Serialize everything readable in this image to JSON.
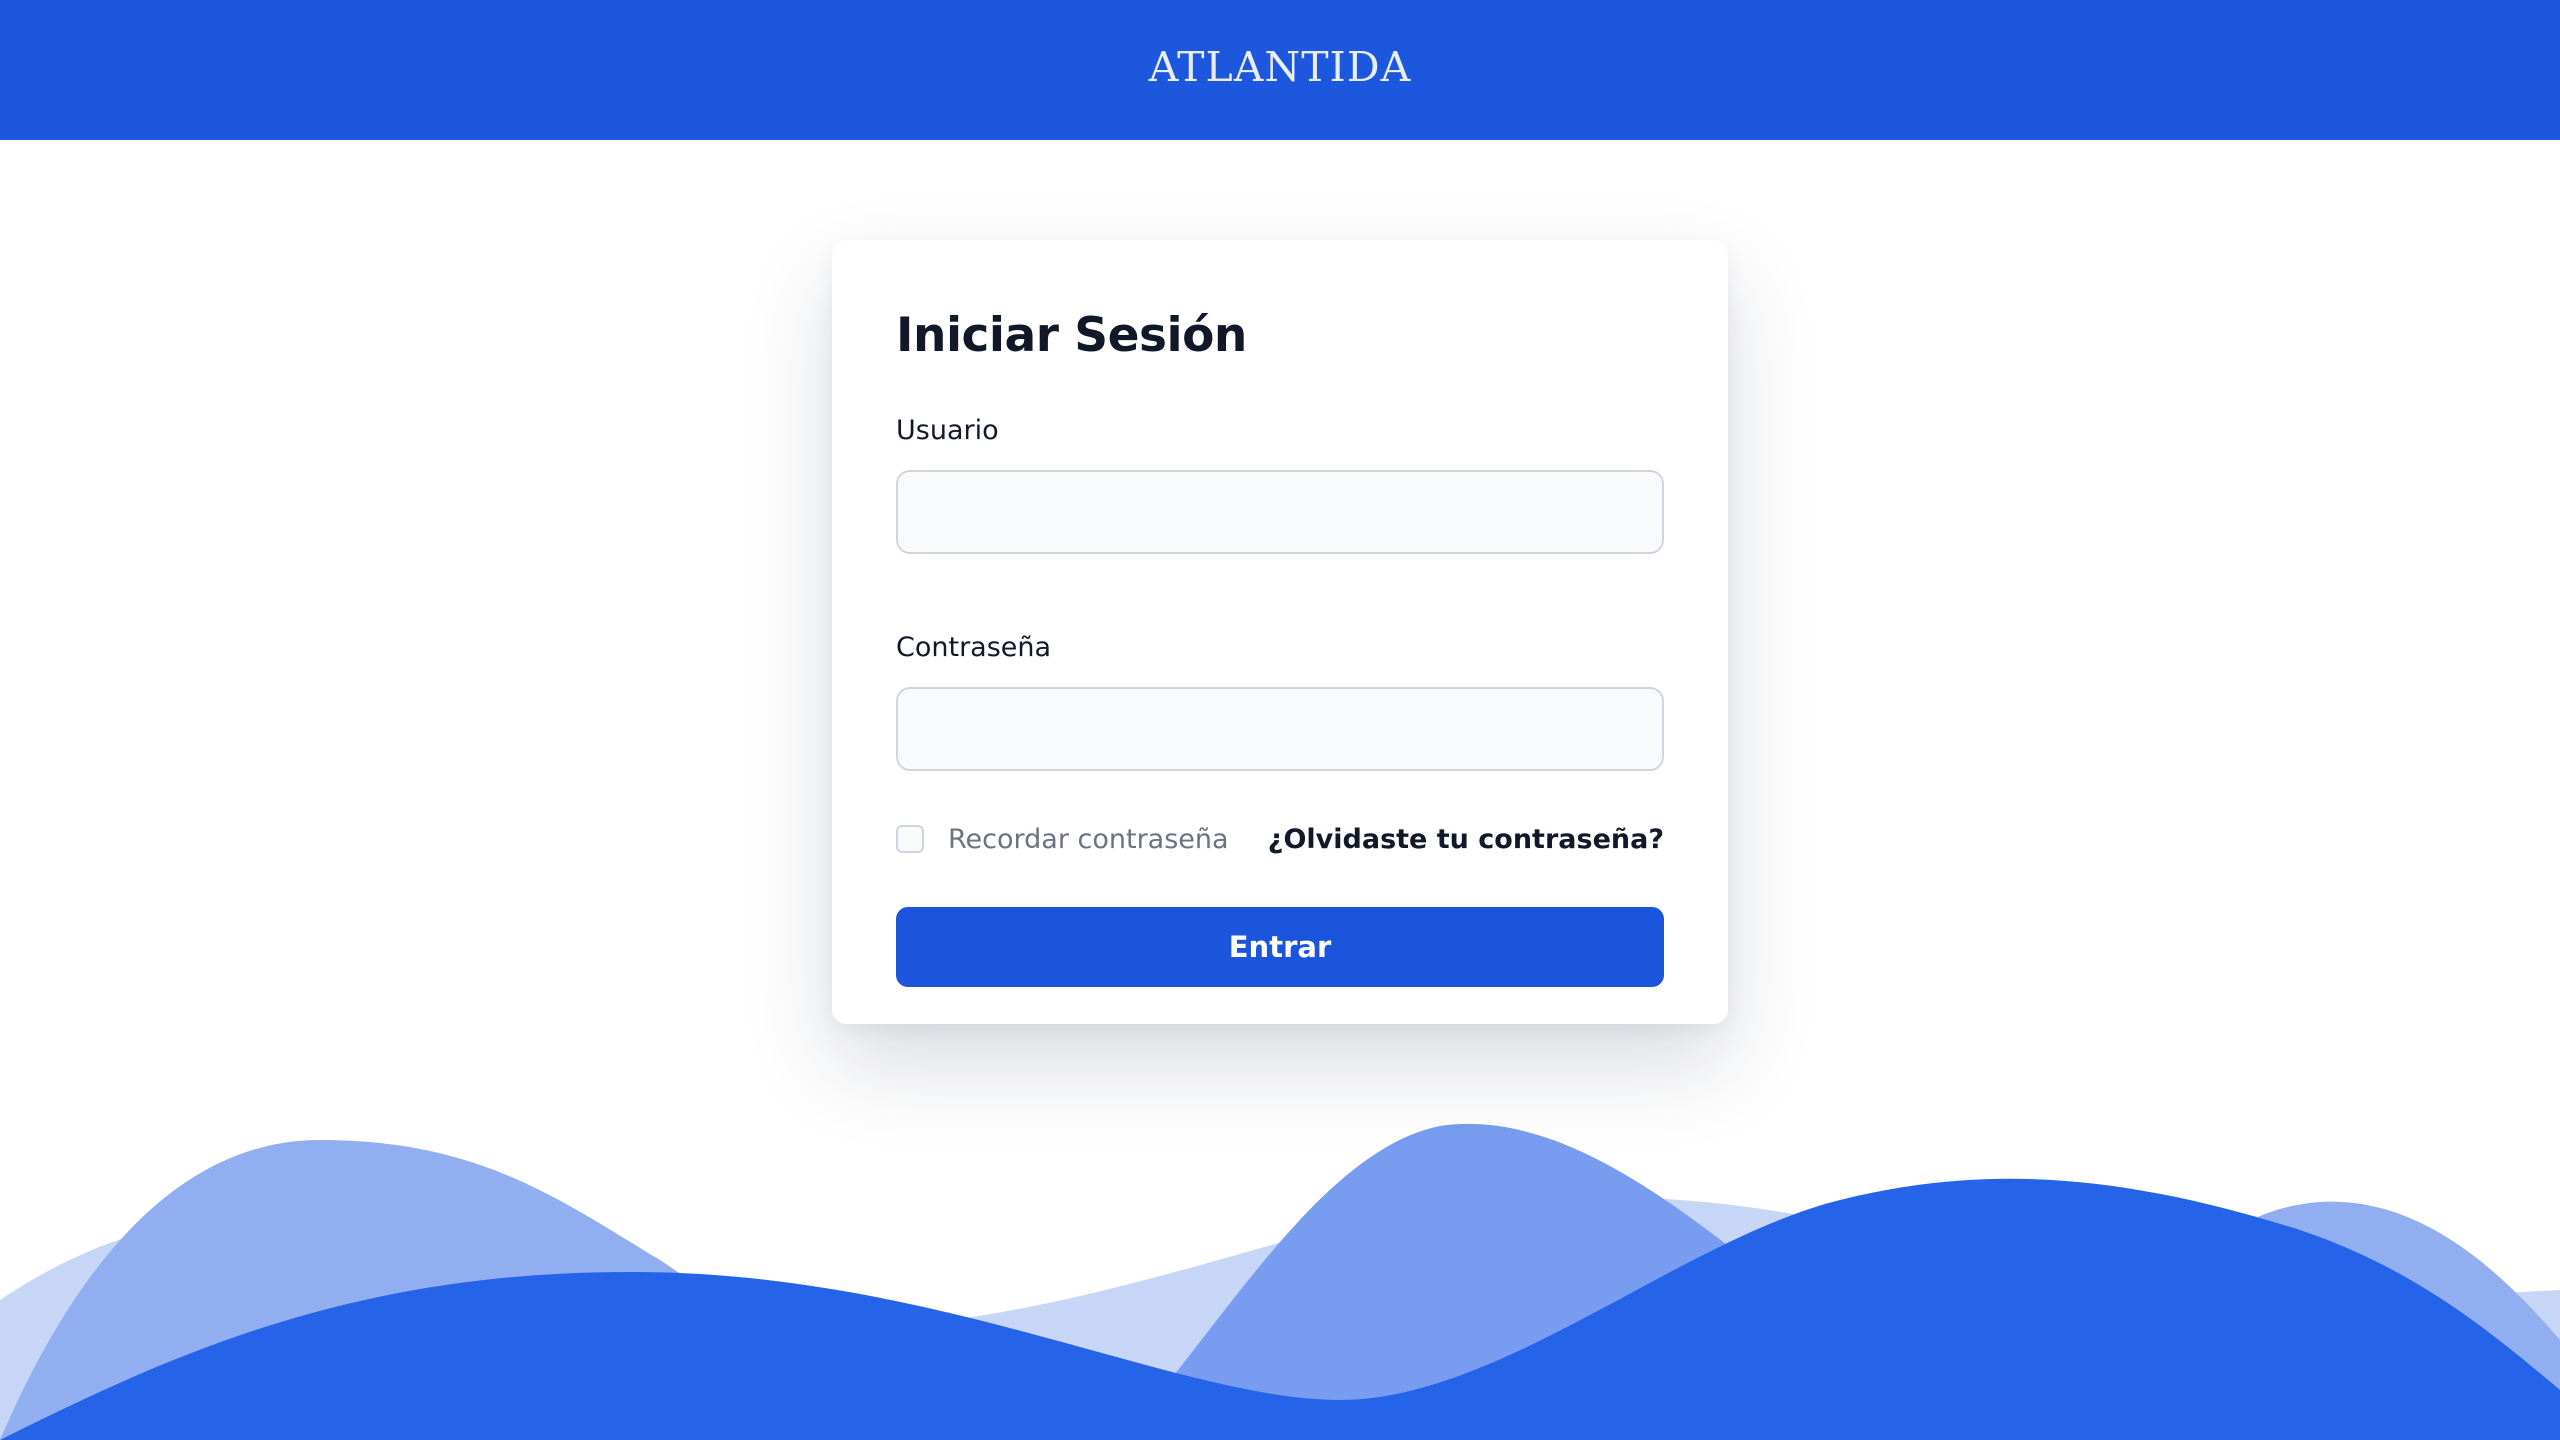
{
  "header": {
    "logo_text": "ATLANTIDA",
    "background_color": "#1d57dd"
  },
  "login_form": {
    "title": "Iniciar Sesión",
    "username_label": "Usuario",
    "username_value": "",
    "password_label": "Contraseña",
    "password_value": "",
    "remember_label": "Recordar contraseña",
    "remember_checked": false,
    "forgot_link": "¿Olvidaste tu contraseña?",
    "submit_label": "Entrar",
    "accent_color": "#1b55dc"
  },
  "decoration": {
    "wave_colors": [
      "#c7d6f6",
      "#91aff0",
      "#789df0",
      "#2563e8"
    ]
  }
}
